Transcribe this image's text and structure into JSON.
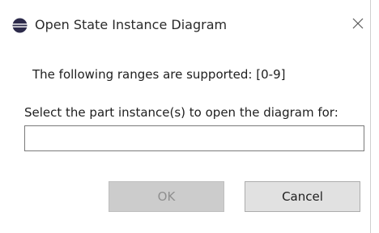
{
  "window": {
    "title": "Open State Instance Diagram",
    "icon": "eclipse-icon",
    "close_icon": "close-icon"
  },
  "body": {
    "ranges_text": "The following ranges are supported: [0-9]",
    "select_label": "Select the part instance(s) to open the diagram for:",
    "instance_input": {
      "value": "",
      "placeholder": ""
    }
  },
  "buttons": {
    "ok_label": "OK",
    "ok_enabled": false,
    "cancel_label": "Cancel"
  },
  "colors": {
    "icon_dark": "#2c2a4a",
    "icon_band": "#ffffff",
    "disabled_button_bg": "#cccccc",
    "button_bg": "#e1e1e1",
    "input_border": "#7a7a7a"
  }
}
